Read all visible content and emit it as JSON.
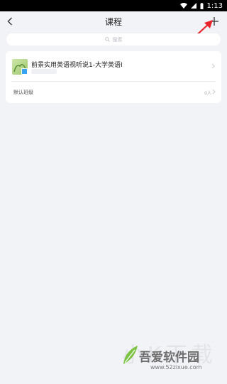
{
  "status_bar": {
    "time": "1:13"
  },
  "header": {
    "title": "课程"
  },
  "search": {
    "placeholder": "搜索"
  },
  "course": {
    "title": "前景实用英语视听说1-大学英语I",
    "class_name": "默认班级",
    "class_count": "0人"
  },
  "watermark": {
    "big_text": "小K下载",
    "name": "吾爱软件园",
    "url": "www.52zixue.com"
  },
  "colors": {
    "background": "#f2f3f7",
    "annotation_arrow": "#e8232a",
    "card": "#ffffff"
  }
}
